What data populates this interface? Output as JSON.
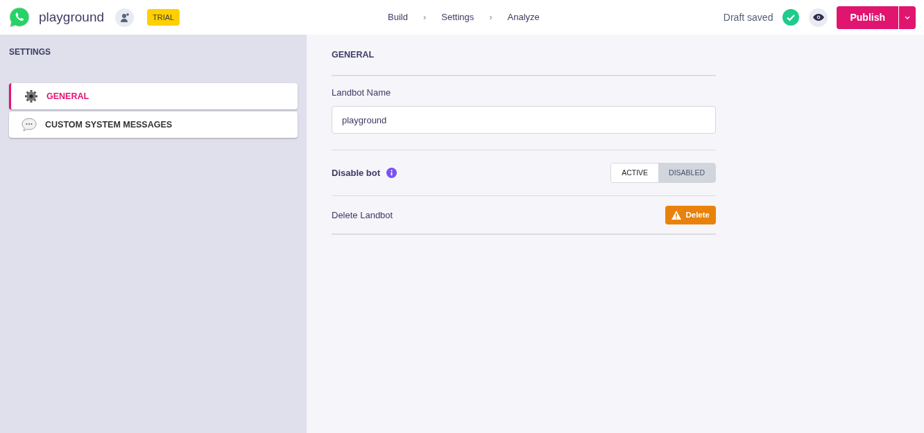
{
  "header": {
    "bot_name": "playground",
    "badge": "TRIAL",
    "nav": [
      {
        "label": "Build"
      },
      {
        "label": "Settings"
      },
      {
        "label": "Analyze"
      }
    ],
    "separator": "›",
    "status": "Draft saved",
    "publish": "Publish"
  },
  "sidebar": {
    "title": "SETTINGS",
    "items": [
      {
        "label": "GENERAL",
        "kind": "gear",
        "selected": true
      },
      {
        "label": "CUSTOM SYSTEM MESSAGES",
        "kind": "chat",
        "selected": false
      }
    ]
  },
  "main": {
    "title": "GENERAL",
    "name_label": "Landbot Name",
    "name_value": "playground",
    "disable_label": "Disable bot",
    "toggle": [
      {
        "label": "ACTIVE",
        "selected": true
      },
      {
        "label": "DISABLED",
        "selected": false
      }
    ],
    "delete_label": "Delete Landbot",
    "delete_button": "Delete"
  }
}
